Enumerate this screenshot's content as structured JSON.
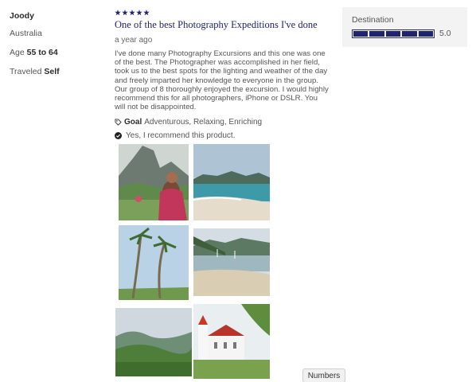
{
  "reviewer": {
    "name": "Joody",
    "location": "Australia",
    "age_label": "Age",
    "age_value": "55 to 64",
    "traveled_label": "Traveled",
    "traveled_value": "Self"
  },
  "review": {
    "rating": 5,
    "title": "One of the best Photography Expeditions I've done",
    "date": "a year ago",
    "body": "I've done many Photography Excursions and this one was one of the best. The Photographer was accomplished in her field, took us to the best spots for the lighting and weather of the day and freely imparted her knowledge to everyone in the group. Our group of 8 thoroughly enjoyed the excursion. I would highly recommend this for all photographers, iPhone or DSLR. You will not be disappointed.",
    "goal_label": "Goal",
    "goal_value": "Adventurous, Relaxing, Enriching",
    "recommend_text": "Yes, I recommend this product."
  },
  "destination": {
    "label": "Destination",
    "score": "5.0",
    "score_fraction": 1.0
  },
  "photos": [
    {
      "name": "photo-woman-mountain"
    },
    {
      "name": "photo-lagoon-beach"
    },
    {
      "name": "photo-palm-trees"
    },
    {
      "name": "photo-bay-boats"
    },
    {
      "name": "photo-green-hills"
    },
    {
      "name": "photo-white-church"
    }
  ],
  "numbers_button": "Numbers",
  "colors": {
    "accent": "#1f2370",
    "panel_bg": "#f3f3f3"
  }
}
